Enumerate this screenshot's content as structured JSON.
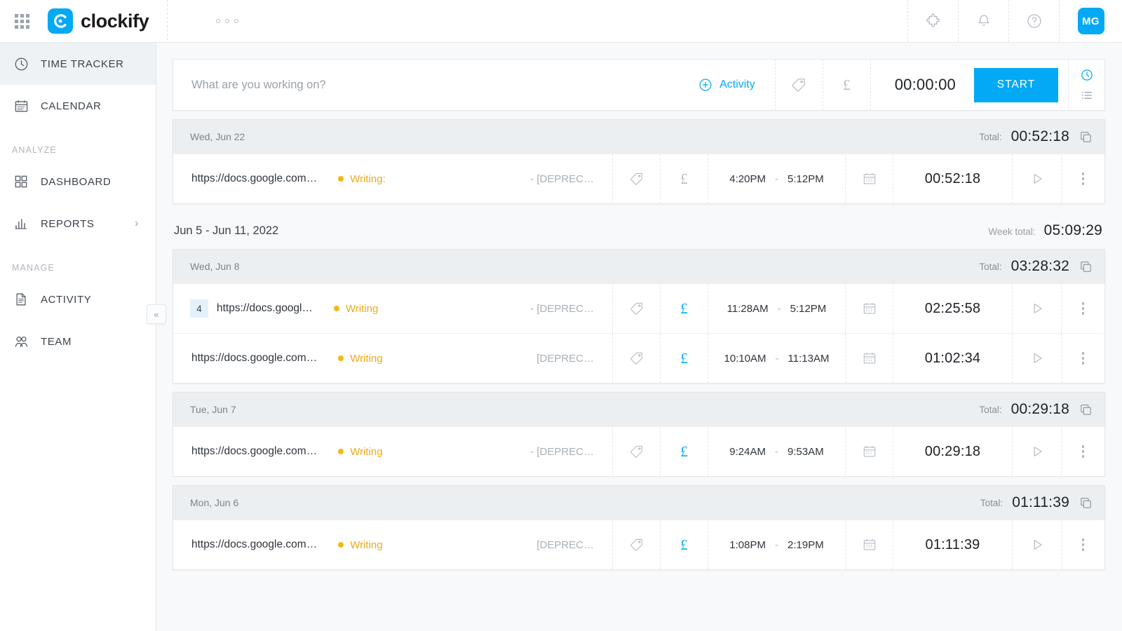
{
  "header": {
    "app_grid_icon": "grid-icon",
    "brand_name": "clockify",
    "more_icon": "three-dots-icon",
    "actions": [
      {
        "name": "integrations-icon",
        "label": "puzzle-icon"
      },
      {
        "name": "notifications-icon",
        "label": "bell-icon"
      },
      {
        "name": "help-icon",
        "label": "question-mark-icon"
      }
    ],
    "avatar_initials": "MG"
  },
  "sidebar": {
    "items": [
      {
        "label": "TIME TRACKER",
        "icon": "clock-icon",
        "active": true
      },
      {
        "label": "CALENDAR",
        "icon": "calendar-icon",
        "active": false
      }
    ],
    "section_analyze": "ANALYZE",
    "analyze_items": [
      {
        "label": "DASHBOARD",
        "icon": "dashboard-icon",
        "chevron": false
      },
      {
        "label": "REPORTS",
        "icon": "bar-chart-icon",
        "chevron": true
      }
    ],
    "section_manage": "MANAGE",
    "manage_items": [
      {
        "label": "ACTIVITY",
        "icon": "document-icon"
      },
      {
        "label": "TEAM",
        "icon": "people-icon"
      }
    ],
    "collapse_label": "«"
  },
  "timer": {
    "placeholder": "What are you working on?",
    "value": "",
    "activity_label": "Activity",
    "tag_icon": "tag-icon",
    "billable_icon": "pound-icon",
    "billable_symbol": "£",
    "duration": "00:00:00",
    "start_label": "START",
    "mode_timer_icon": "clock-icon",
    "mode_manual_icon": "list-icon"
  },
  "labels": {
    "total": "Total:",
    "week_total": "Week total:",
    "dash": "-"
  },
  "colors": {
    "accent": "#03a9f4",
    "project": "#f0a819",
    "day_header_bg": "#eceff1",
    "badge_bg": "#e3f1fb"
  },
  "days": [
    {
      "date": "Wed, Jun 22",
      "total": "00:52:18",
      "entries": [
        {
          "badge": "",
          "description": "https://docs.google.com…",
          "project": "Writing:",
          "task": "- [DEPREC…",
          "billable": false,
          "start": "4:20PM",
          "end": "5:12PM",
          "duration": "00:52:18"
        }
      ]
    }
  ],
  "week": {
    "range": "Jun 5 - Jun 11, 2022",
    "total": "05:09:29",
    "days": [
      {
        "date": "Wed, Jun 8",
        "total": "03:28:32",
        "entries": [
          {
            "badge": "4",
            "description": "https://docs.googl…",
            "project": "Writing",
            "task": "- [DEPREC…",
            "billable": true,
            "start": "11:28AM",
            "end": "5:12PM",
            "duration": "02:25:58"
          },
          {
            "badge": "",
            "description": "https://docs.google.com…",
            "project": "Writing",
            "task": "[DEPREC…",
            "billable": true,
            "start": "10:10AM",
            "end": "11:13AM",
            "duration": "01:02:34"
          }
        ]
      },
      {
        "date": "Tue, Jun 7",
        "total": "00:29:18",
        "entries": [
          {
            "badge": "",
            "description": "https://docs.google.com…",
            "project": "Writing",
            "task": "- [DEPREC…",
            "billable": true,
            "start": "9:24AM",
            "end": "9:53AM",
            "duration": "00:29:18"
          }
        ]
      },
      {
        "date": "Mon, Jun 6",
        "total": "01:11:39",
        "entries": [
          {
            "badge": "",
            "description": "https://docs.google.com…",
            "project": "Writing",
            "task": "[DEPREC…",
            "billable": true,
            "start": "1:08PM",
            "end": "2:19PM",
            "duration": "01:11:39"
          }
        ]
      }
    ]
  }
}
